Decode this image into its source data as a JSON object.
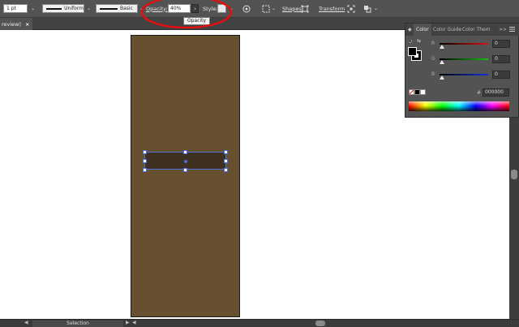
{
  "control_bar": {
    "stroke_weight": "1 pt",
    "profile_label": "Uniform",
    "brush_label": "Basic",
    "opacity_label": "Opacity:",
    "opacity_value": "40%",
    "style_label": "Style:",
    "shapes_label": "Shapes",
    "transform_label": "Transform"
  },
  "tooltip": {
    "text": "Opacity"
  },
  "document_tab": {
    "label": "review)",
    "close": "×"
  },
  "status_bar": {
    "tool": "Selection"
  },
  "color_panel": {
    "tabs": [
      "Color",
      "Color Guide",
      "Color Them"
    ],
    "more": ">>",
    "menu_icon": "hamburger-icon",
    "sliders": [
      {
        "label": "R",
        "value": "0",
        "color": "#e01010"
      },
      {
        "label": "G",
        "value": "0",
        "color": "#10c010"
      },
      {
        "label": "B",
        "value": "0",
        "color": "#1030e0"
      }
    ],
    "hex_label": "#",
    "hex_value": "000000"
  },
  "colors": {
    "artboard_fill": "#665030",
    "selected_rect_fill": "#3e3120",
    "selection_color": "#4a6fd9",
    "annotation_red": "#e01010"
  }
}
